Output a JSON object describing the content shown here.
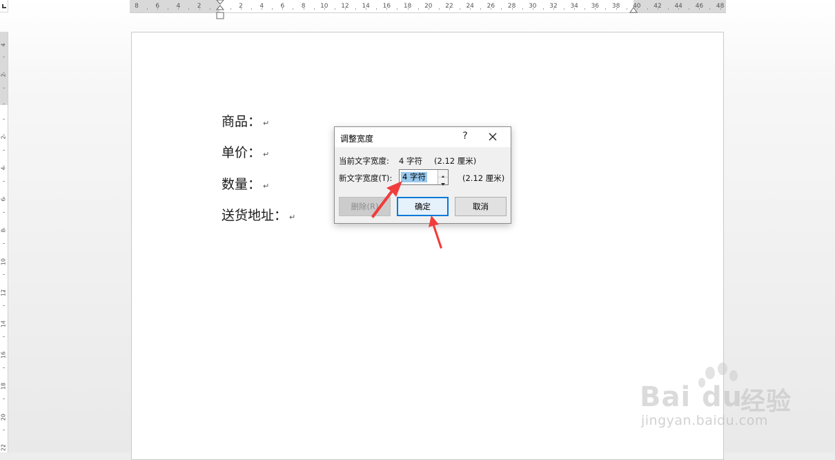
{
  "ruler": {
    "horizontal_numbers": [
      "8",
      "6",
      "4",
      "2",
      "2",
      "4",
      "6",
      "8",
      "10",
      "12",
      "14",
      "16",
      "18",
      "20",
      "22",
      "24",
      "26",
      "28",
      "30",
      "32",
      "34",
      "36",
      "38",
      "40",
      "42",
      "44",
      "46",
      "48"
    ],
    "vertical_numbers": [
      "4",
      "2",
      "2",
      "4",
      "6",
      "8",
      "10",
      "12",
      "14",
      "16",
      "18",
      "20",
      "22"
    ]
  },
  "document": {
    "lines": [
      {
        "text": "商品：",
        "mark": "↵"
      },
      {
        "text": "单价：",
        "mark": "↵"
      },
      {
        "text": "数量：",
        "mark": "↵"
      },
      {
        "text": "送货地址：",
        "mark": "↵"
      }
    ]
  },
  "dialog": {
    "title": "调整宽度",
    "help_glyph": "?",
    "current_label": "当前文字宽度:",
    "current_value": "4 字符",
    "current_cm": "(2.12 厘米)",
    "new_label": "新文字宽度(T):",
    "new_value": "4 字符",
    "new_cm": "(2.12 厘米)",
    "delete_button": "删除(R)",
    "ok_button": "确定",
    "cancel_button": "取消"
  },
  "annotations": {
    "arrow_color": "#f03c3c",
    "arrows": [
      "arrow-to-width-input",
      "arrow-to-ok-button"
    ]
  },
  "watermark": {
    "logo_text": "Bai",
    "logo_text2": "du",
    "logo_suffix": "经验",
    "url": "jingyan.baidu.com"
  },
  "icons": {
    "close": "close-icon",
    "spin_up": "chevron-up-icon",
    "spin_down": "chevron-down-icon"
  }
}
